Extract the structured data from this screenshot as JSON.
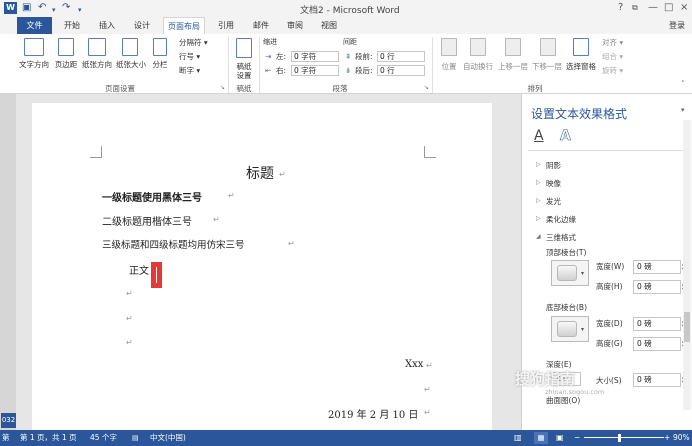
{
  "window": {
    "title": "文档2 - Microsoft Word",
    "app_icon": "W",
    "help": "?",
    "minimize": "—",
    "maximize": "□",
    "close": "×",
    "login": "登录",
    "restore": "⧉"
  },
  "tabs": [
    "文件",
    "开始",
    "插入",
    "设计",
    "页面布局",
    "引用",
    "邮件",
    "审阅",
    "视图"
  ],
  "ribbon": {
    "page_setup": {
      "label": "页面设置",
      "buttons": [
        "文字方向",
        "页边距",
        "纸张方向",
        "纸张大小",
        "分栏"
      ],
      "small": [
        "分隔符 ▾",
        "行号 ▾",
        "断字 ▾"
      ]
    },
    "draft": {
      "label": "稿纸",
      "button": "稿纸\n设置"
    },
    "paragraph": {
      "label": "段落",
      "indent": "缩进",
      "spacing": "间距",
      "left": "左:",
      "right": "右:",
      "before": "段前:",
      "after": "段后:",
      "left_val": "0 字符",
      "right_val": "0 字符",
      "before_val": "0 行",
      "after_val": "0 行"
    },
    "arrange": {
      "label": "排列",
      "buttons": [
        "位置",
        "自动换行",
        "上移一层",
        "下移一层",
        "选择窗格"
      ],
      "small": [
        "对齐 ▾",
        "组合 ▾",
        "旋转 ▾"
      ]
    }
  },
  "document": {
    "title": "标题",
    "h1": "一级标题使用黑体三号",
    "h2": "二级标题用楷体三号",
    "h3": "三级标题和四级标题均用仿宋三号",
    "body": "正文",
    "signature": "Xxx",
    "date": "2019 年 2 月 10 日"
  },
  "panel": {
    "title": "设置文本效果格式",
    "sections": [
      "阴影",
      "映像",
      "发光",
      "柔化边缘",
      "三维格式"
    ],
    "top_bevel": "顶部棱台(T)",
    "bottom_bevel": "底部棱台(B)",
    "width": "宽度(W)",
    "height": "高度(H)",
    "width_d": "宽度(D)",
    "height_g": "高度(G)",
    "val": "0 磅",
    "depth": "深度(E)",
    "depth_size": "大小(S)",
    "contour": "曲面图(O)",
    "text_fill_icon": "A",
    "text_effects_icon": "A"
  },
  "status": {
    "page": "第 1 页，共 1 页",
    "words": "45 个字",
    "lang": "中文(中国)",
    "zoom": "90%",
    "left_edge": "第",
    "left_num": "032"
  },
  "watermark": {
    "text": "搜狗指南",
    "url": "zhinan.sogou.com"
  }
}
